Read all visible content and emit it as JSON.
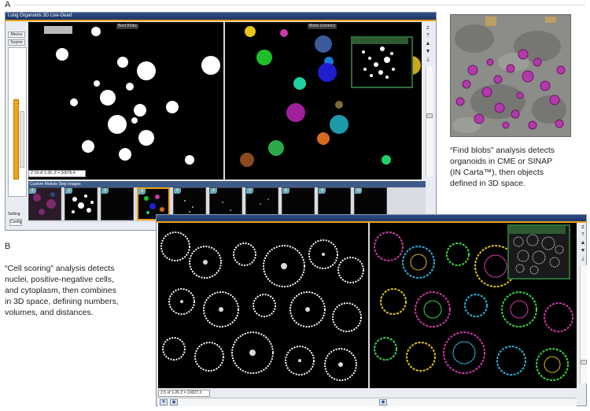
{
  "panels": {
    "a": "A",
    "b": "B"
  },
  "window_a": {
    "title": "Lung Organoids 3D Live-Dead",
    "side_buttons": [
      "Measu",
      "Segme"
    ],
    "setting_label": "Setting",
    "config_label": "Config",
    "viewport_left_label": "Best Blobs",
    "viewport_right_label": "Blobs (connect",
    "status": "Z 19 of 1-36, Z = 10076.4",
    "strip_title": "Custom Module Step Images",
    "thumb_numbers": [
      "1",
      "2",
      "3",
      "4",
      "5",
      "6",
      "7",
      "8",
      "9",
      "10"
    ],
    "selected_thumb": 4
  },
  "caption_a": {
    "lines": [
      "“Find blobs” analysis detects",
      "organoids in CME or SINAP",
      "(IN Carta™), then objects",
      "defined in 3D space."
    ]
  },
  "window_b": {
    "status": "2.5 of 1-26 Z = 10027.3"
  },
  "caption_b": {
    "lines": [
      "“Cell scoring” analysis detects",
      "nuclei, positive-negative cells,",
      "and cytoplasm, then combines",
      "in 3D space, defining numbers,",
      "volumes, and distances."
    ]
  },
  "colors": {
    "accent": "#f0a21a",
    "title_bar": "#1d3566",
    "organoid_magenta": "#b23aaa"
  }
}
